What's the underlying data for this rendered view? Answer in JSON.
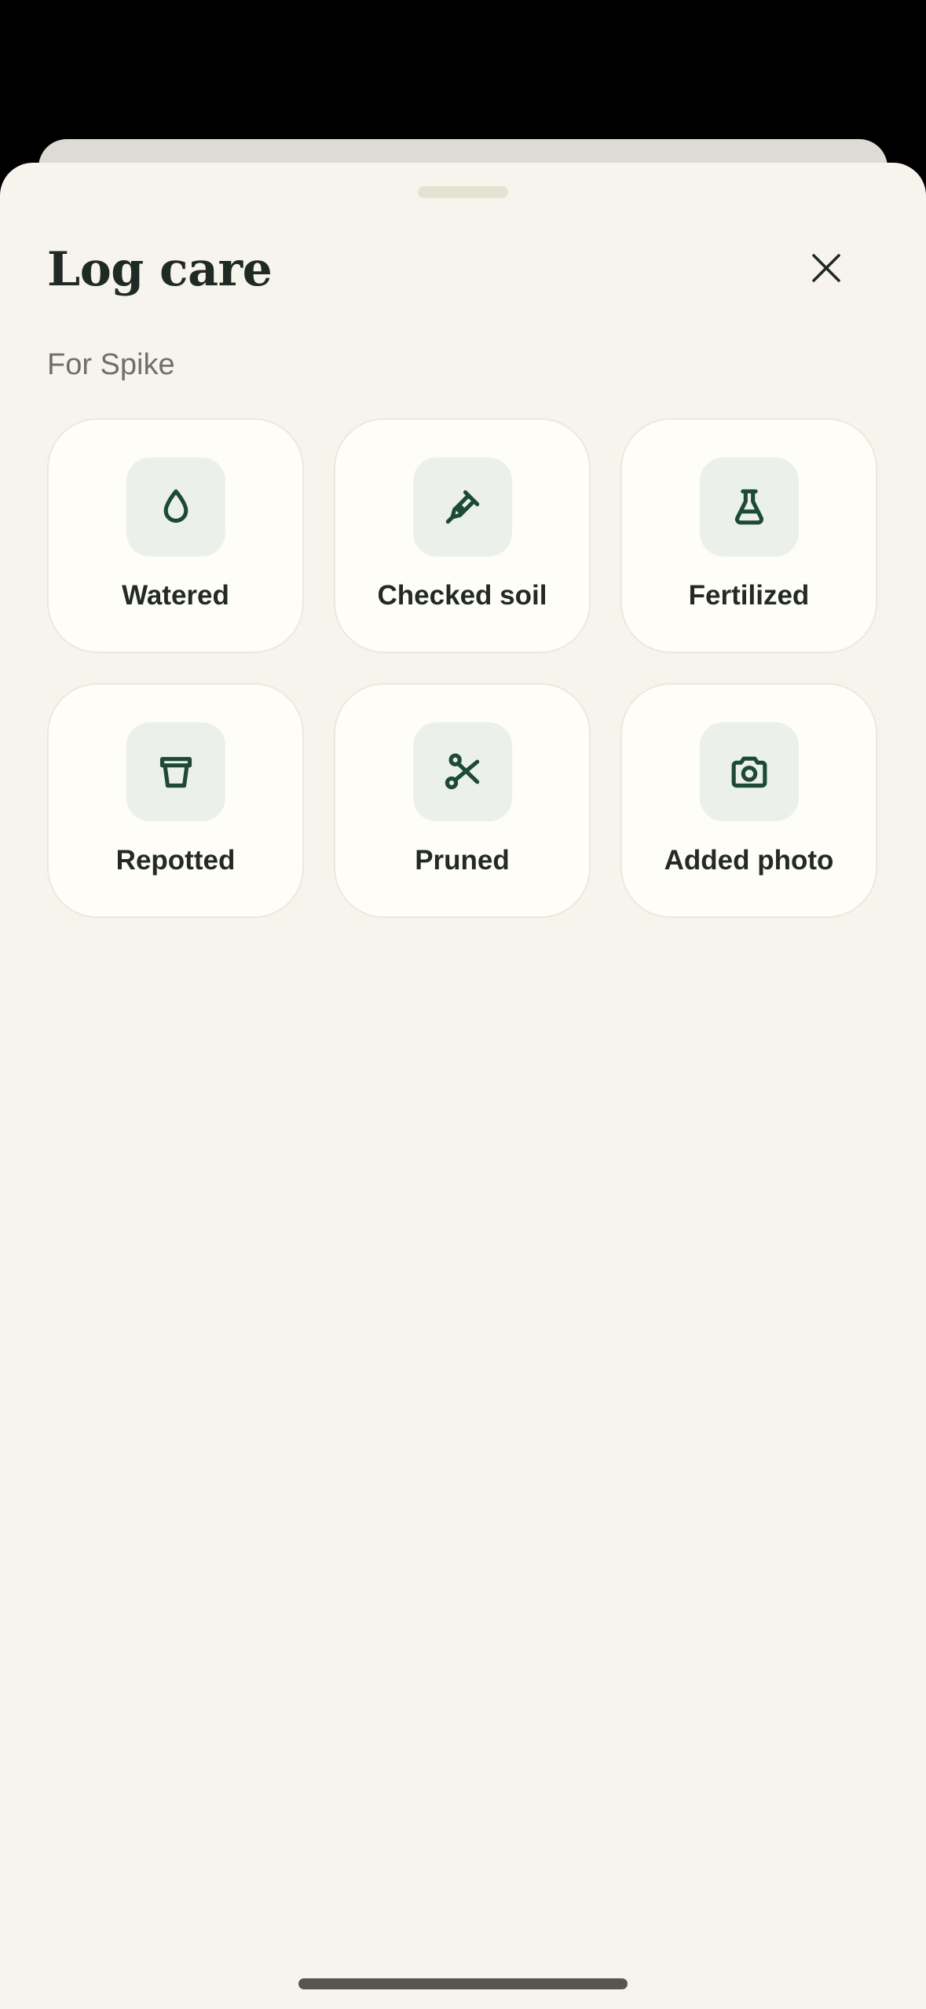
{
  "sheet": {
    "title": "Log care",
    "subtitle": "For Spike",
    "close_icon": "close-icon"
  },
  "actions": [
    {
      "label": "Watered",
      "icon": "water-drop-icon"
    },
    {
      "label": "Checked soil",
      "icon": "soil-probe-icon"
    },
    {
      "label": "Fertilized",
      "icon": "flask-icon"
    },
    {
      "label": "Repotted",
      "icon": "pot-icon"
    },
    {
      "label": "Pruned",
      "icon": "scissors-icon"
    },
    {
      "label": "Added photo",
      "icon": "camera-icon"
    }
  ],
  "colors": {
    "sheet_background": "#f7f4ee",
    "tile_background": "#fefdf8",
    "icon_chip": "#ebf1ea",
    "icon_stroke": "#1d4a36",
    "text_primary": "#1f2a25",
    "text_secondary": "#6f6f68"
  }
}
